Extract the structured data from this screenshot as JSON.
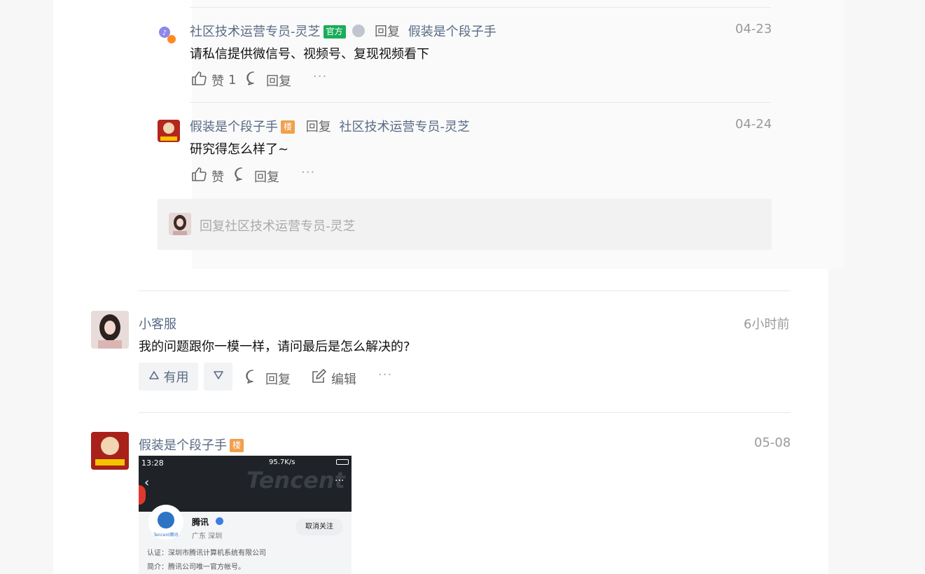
{
  "replies": [
    {
      "author": "社区技术运营专员-灵芝",
      "badge": "官方",
      "reply_label": "回复",
      "reply_to": "假装是个段子手",
      "time": "04-23",
      "content": "请私信提供微信号、视频号、复现视频看下",
      "like_label": "赞",
      "like_count": "1",
      "comment_label": "回复"
    },
    {
      "author": "假装是个段子手",
      "badge": "楼",
      "reply_label": "回复",
      "reply_to": "社区技术运营专员-灵芝",
      "time": "04-24",
      "content": "研究得怎么样了~",
      "like_label": "赞",
      "comment_label": "回复"
    }
  ],
  "reply_input": {
    "placeholder": "回复社区技术运营专员-灵芝"
  },
  "comments": [
    {
      "author": "小客服",
      "time": "6小时前",
      "content": "我的问题跟你一模一样，请问最后是怎么解决的?",
      "useful_label": "有用",
      "reply_label": "回复",
      "edit_label": "编辑"
    },
    {
      "author": "假装是个段子手",
      "badge": "楼",
      "time": "05-08"
    }
  ],
  "screenshot": {
    "status_time": "13:28",
    "status_net": "95.7K/s",
    "watermark": "Tencent",
    "account_name": "腾讯",
    "location": "广东 深圳",
    "unfollow_label": "取消关注",
    "cert": "认证：深圳市腾讯计算机系统有限公司",
    "intro": "简介：腾讯公司唯一官方帐号。",
    "logo_text": "Tencent腾讯"
  },
  "colors": {
    "link": "#596b85",
    "official": "#1aad5a",
    "lou": "#f0a04b"
  }
}
